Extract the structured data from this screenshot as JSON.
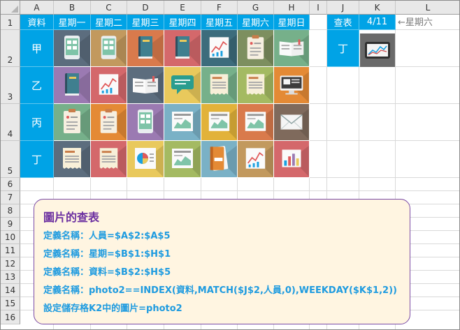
{
  "columns": [
    "A",
    "B",
    "C",
    "D",
    "E",
    "F",
    "G",
    "H",
    "I",
    "J",
    "K",
    "L"
  ],
  "rows": [
    "1",
    "2",
    "3",
    "4",
    "5",
    "6",
    "7",
    "8",
    "9",
    "10",
    "11",
    "12",
    "13",
    "14",
    "15",
    "16"
  ],
  "row1": {
    "a1": "資料",
    "weekdays": [
      "星期一",
      "星期二",
      "星期三",
      "星期四",
      "星期五",
      "星期六",
      "星期日"
    ],
    "j1": "查表",
    "k1": "4/11",
    "l1": "←星期六"
  },
  "people": [
    "甲",
    "乙",
    "丙",
    "丁"
  ],
  "j2": "丁",
  "icons": [
    [
      "tablet-icon",
      "tablet-icon",
      "book-icon",
      "book-icon",
      "chart-icon",
      "clipboard-icon",
      "open-book-icon"
    ],
    [
      "book-icon",
      "chart-icon",
      "open-book-icon",
      "chat-icon",
      "receipt-icon",
      "receipt-icon",
      "monitor-icon"
    ],
    [
      "clipboard-icon",
      "clipboard-icon",
      "tablet-icon",
      "report-icon",
      "report-icon",
      "report-icon",
      "mail-icon"
    ],
    [
      "receipt-icon",
      "receipt-icon",
      "pie-chart-icon",
      "report-icon",
      "notebook-icon",
      "chart-icon",
      "bar-chart-icon"
    ]
  ],
  "tile_colors": [
    [
      "#5c6d7e",
      "#c2995e",
      "#d97a4c",
      "#d4686b",
      "#3c6c7c",
      "#7d8f5f",
      "#76b08a"
    ],
    [
      "#9b7ab2",
      "#d4686b",
      "#5c6d7e",
      "#e9c95c",
      "#76b08a",
      "#a4ba62",
      "#e48a35"
    ],
    [
      "#76b08a",
      "#e48a35",
      "#9b7ab2",
      "#7ab1c6",
      "#e2b23a",
      "#d97a4c",
      "#7f6a5c"
    ],
    [
      "#5c6d7e",
      "#d4686b",
      "#e9c95c",
      "#a4ba62",
      "#7ab1c6",
      "#c2995e",
      "#d4686b"
    ]
  ],
  "note": {
    "title": "圖片的查表",
    "lines": [
      "定義名稱：人員=$A$2:$A$5",
      "定義名稱：星期=$B$1:$H$1",
      "定義名稱：資料=$B$2:$H$5",
      "定義名稱：photo2==INDEX(資料,MATCH($J$2,人員,0),WEEKDAY($K$1,2))",
      "設定儲存格K2中的圖片=photo2"
    ]
  },
  "colors": {
    "header_blue": "#00a3e6",
    "note_border": "#7a4aa6",
    "note_bg": "#fff5e1",
    "note_title": "#6b2fa0",
    "note_text": "#1e9be0"
  }
}
